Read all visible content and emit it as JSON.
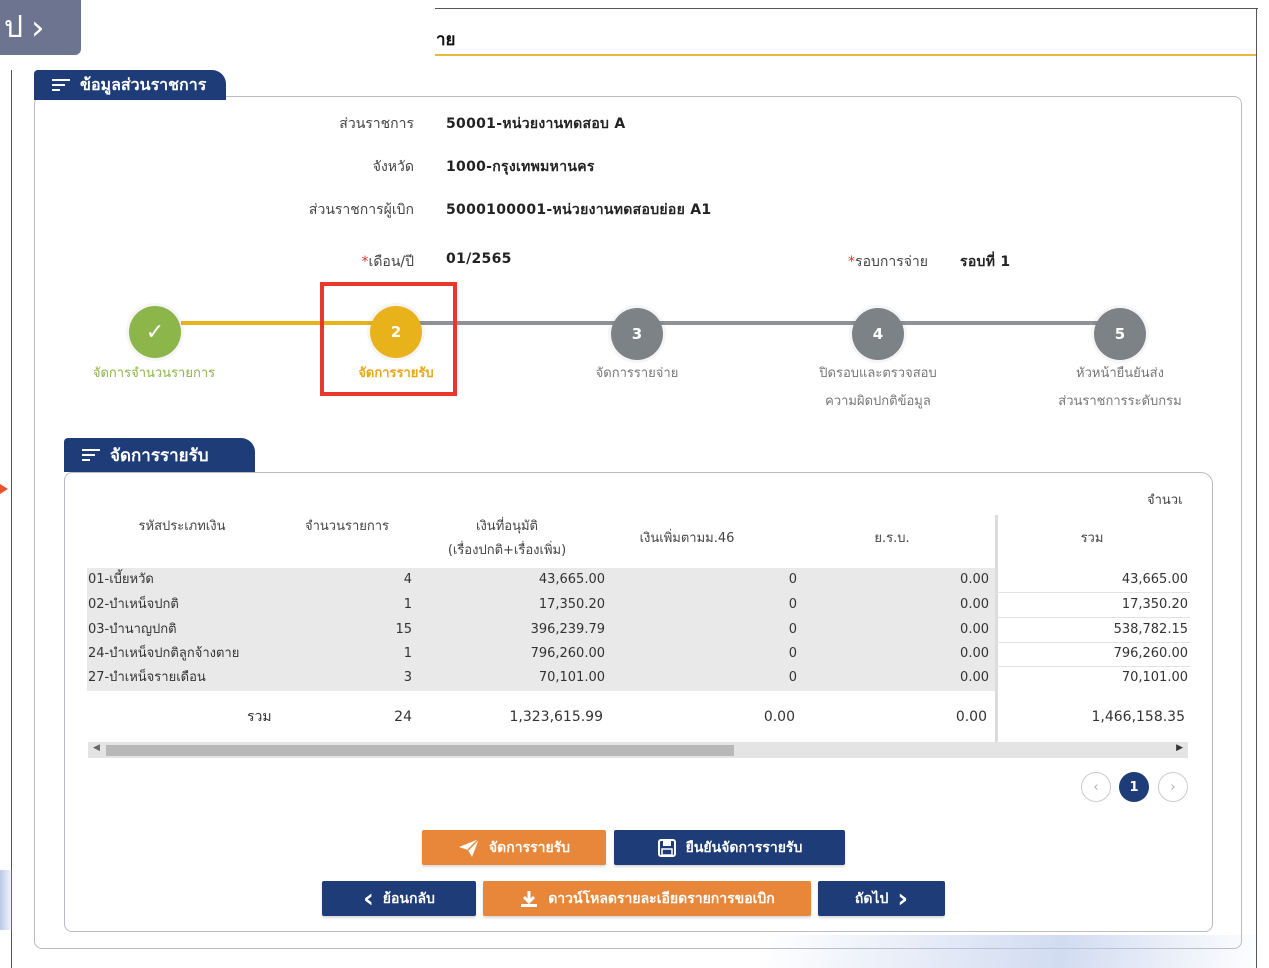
{
  "nav": {
    "chip_text": "ป",
    "chip_icon": "chevron-right-icon"
  },
  "header": {
    "title": "าย"
  },
  "agency_section": {
    "tab_label": "ข้อมูลส่วนราชการ",
    "fields": [
      {
        "label": "ส่วนราชการ",
        "value": "50001-หน่วยงานทดสอบ A"
      },
      {
        "label": "จังหวัด",
        "value": "1000-กรุงเทพมหานคร"
      },
      {
        "label": "ส่วนราชการผู้เบิก",
        "value": "5000100001-หน่วยงานทดสอบย่อย A1"
      }
    ],
    "month_year": {
      "required_mark": "*",
      "label": "เดือน/ปี",
      "value": "01/2565"
    },
    "round": {
      "required_mark": "*",
      "label": "รอบการจ่าย",
      "value": "รอบที่ 1"
    }
  },
  "stepper": {
    "steps": [
      {
        "number": "✓",
        "label_line1": "จัดการจำนวนรายการ",
        "label_line2": "",
        "state": "done",
        "color": "#8cb54a"
      },
      {
        "number": "2",
        "label_line1": "จัดการรายรับ",
        "label_line2": "",
        "state": "current",
        "color": "#e8b21a"
      },
      {
        "number": "3",
        "label_line1": "จัดการรายจ่าย",
        "label_line2": "",
        "state": "pending",
        "color": "#7d8287"
      },
      {
        "number": "4",
        "label_line1": "ปิดรอบและตรวจสอบ",
        "label_line2": "ความผิดปกติข้อมูล",
        "state": "pending",
        "color": "#7d8287"
      },
      {
        "number": "5",
        "label_line1": "หัวหน้ายืนยันส่ง",
        "label_line2": "ส่วนราชการระดับกรม",
        "state": "pending",
        "color": "#7d8287"
      }
    ],
    "highlight_color": "#e8372b"
  },
  "income_section": {
    "tab_label": "จัดการรายรับ",
    "table": {
      "group_header": "จำนวเ",
      "columns": {
        "code": "รหัสประเภทเงิน",
        "count": "จำนวนรายการ",
        "approved_line1": "เงินที่อนุมัติ",
        "approved_line2": "(เรื่องปกติ+เรื่องเพิ่ม)",
        "extra46": "เงินเพิ่มตามม.46",
        "bsu": "ย.ร.บ.",
        "total": "รวม"
      },
      "rows": [
        {
          "code": "01-เบี้ยหวัด",
          "count": "4",
          "approved": "43,665.00",
          "extra46": "0",
          "bsu": "0.00",
          "total": "43,665.00"
        },
        {
          "code": "02-บำเหน็จปกติ",
          "count": "1",
          "approved": "17,350.20",
          "extra46": "0",
          "bsu": "0.00",
          "total": "17,350.20"
        },
        {
          "code": "03-บำนาญปกติ",
          "count": "15",
          "approved": "396,239.79",
          "extra46": "0",
          "bsu": "0.00",
          "total": "538,782.15"
        },
        {
          "code": "24-บำเหน็จปกติลูกจ้างตาย",
          "count": "1",
          "approved": "796,260.00",
          "extra46": "0",
          "bsu": "0.00",
          "total": "796,260.00"
        },
        {
          "code": "27-บำเหน็จรายเดือน",
          "count": "3",
          "approved": "70,101.00",
          "extra46": "0",
          "bsu": "0.00",
          "total": "70,101.00"
        }
      ],
      "summary": {
        "label": "รวม",
        "count": "24",
        "approved": "1,323,615.99",
        "extra46": "0.00",
        "bsu": "0.00",
        "total": "1,466,158.35"
      }
    },
    "pagination": {
      "prev": "‹",
      "current": "1",
      "next": "›"
    }
  },
  "actions": {
    "manage_income": {
      "label": "จัดการรายรับ",
      "icon": "send-icon"
    },
    "confirm_income": {
      "label": "ยืนยันจัดการรายรับ",
      "icon": "save-icon"
    },
    "back": {
      "label": "ย้อนกลับ",
      "icon": "chevron-left-icon"
    },
    "download": {
      "label": "ดาวน์โหลดรายละเอียดรายการขอเบิก",
      "icon": "download-icon"
    },
    "next": {
      "label": "ถัดไป",
      "icon": "chevron-right-icon"
    }
  },
  "colors": {
    "navy": "#1e3c78",
    "orange": "#e8873a",
    "gold": "#e8b21a",
    "green": "#8cb54a",
    "gray": "#7d8287"
  }
}
